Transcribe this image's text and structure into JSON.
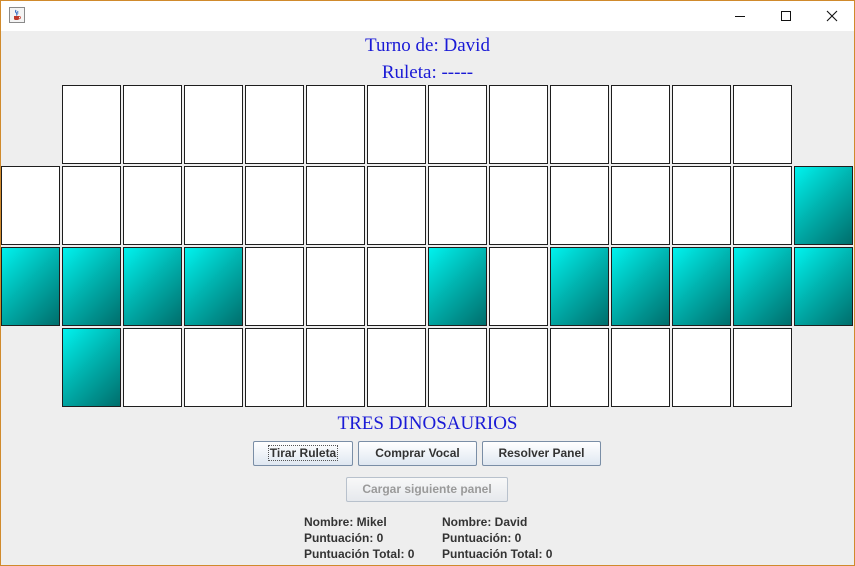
{
  "window": {
    "icon": "java-coffee-icon",
    "controls": [
      "minimize-icon",
      "maximize-icon",
      "close-icon"
    ]
  },
  "header": {
    "turno": "Turno de: David",
    "ruleta": "Ruleta: -----"
  },
  "board": {
    "columns": 14,
    "rows": [
      [
        "empty",
        "white",
        "white",
        "white",
        "white",
        "white",
        "white",
        "white",
        "white",
        "white",
        "white",
        "white",
        "white",
        "empty"
      ],
      [
        "white",
        "white",
        "white",
        "white",
        "white",
        "white",
        "white",
        "white",
        "white",
        "white",
        "white",
        "white",
        "white",
        "teal"
      ],
      [
        "teal",
        "teal",
        "teal",
        "teal",
        "white",
        "white",
        "white",
        "teal",
        "white",
        "teal",
        "teal",
        "teal",
        "teal",
        "teal"
      ],
      [
        "empty",
        "teal",
        "white",
        "white",
        "white",
        "white",
        "white",
        "white",
        "white",
        "white",
        "white",
        "white",
        "white",
        "empty"
      ]
    ],
    "colors": {
      "teal_light": "#00f2ee",
      "teal_dark": "#006e6c",
      "border": "#1e1e1e"
    }
  },
  "phrase": "TRES DINOSAURIOS",
  "buttons": {
    "tirar": "Tirar Ruleta",
    "comprar": "Comprar Vocal",
    "resolver": "Resolver Panel",
    "cargar": "Cargar siguiente panel"
  },
  "players": [
    {
      "nombre": "Nombre: Mikel",
      "puntuacion": "Puntuación: 0",
      "total": "Puntuación Total: 0"
    },
    {
      "nombre": "Nombre: David",
      "puntuacion": "Puntuación: 0",
      "total": "Puntuación Total: 0"
    }
  ],
  "colors": {
    "accent_text": "#1a1ad6",
    "window_border": "#d08a2c",
    "background": "#eeeeee"
  }
}
